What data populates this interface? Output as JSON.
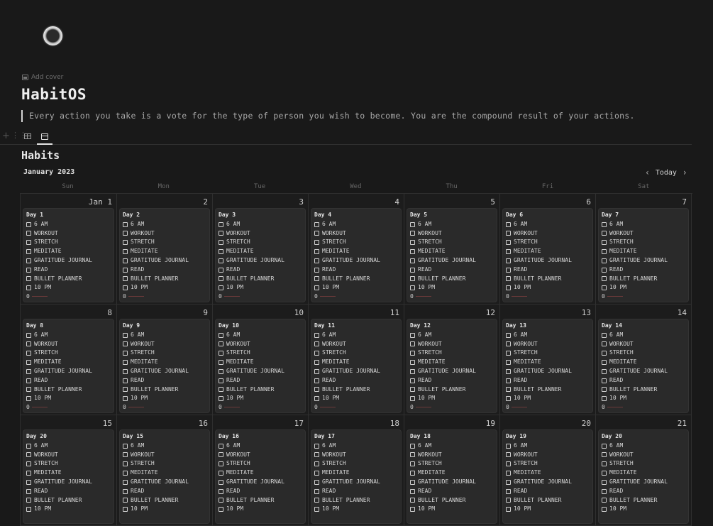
{
  "page": {
    "add_cover": "Add cover",
    "title": "HabitOS",
    "quote": "Every action you take is a vote for the type of person you wish to become. You are the compound result of your actions.",
    "database_title": "Habits"
  },
  "toolbar": {
    "views": [
      "table-view",
      "calendar-view"
    ],
    "active_view": "calendar-view"
  },
  "calendar": {
    "month_label": "January 2023",
    "today_label": "Today",
    "weekdays": [
      "Sun",
      "Mon",
      "Tue",
      "Wed",
      "Thu",
      "Fri",
      "Sat"
    ],
    "tasks": [
      "6 AM",
      "WORKOUT",
      "STRETCH",
      "MEDITATE",
      "GRATITUDE JOURNAL",
      "READ",
      "BULLET PLANNER",
      "10 PM"
    ],
    "weeks": [
      [
        {
          "date": "Jan 1",
          "title": "Day 1",
          "count": "0"
        },
        {
          "date": "2",
          "title": "Day 2",
          "count": "0"
        },
        {
          "date": "3",
          "title": "Day 3",
          "count": "0"
        },
        {
          "date": "4",
          "title": "Day 4",
          "count": "0"
        },
        {
          "date": "5",
          "title": "Day 5",
          "count": "0"
        },
        {
          "date": "6",
          "title": "Day 6",
          "count": "0"
        },
        {
          "date": "7",
          "title": "Day 7",
          "count": "0"
        }
      ],
      [
        {
          "date": "8",
          "title": "Day 8",
          "count": "0"
        },
        {
          "date": "9",
          "title": "Day 9",
          "count": "0"
        },
        {
          "date": "10",
          "title": "Day 10",
          "count": "0"
        },
        {
          "date": "11",
          "title": "Day 11",
          "count": "0"
        },
        {
          "date": "12",
          "title": "Day 12",
          "count": "0"
        },
        {
          "date": "13",
          "title": "Day 13",
          "count": "0"
        },
        {
          "date": "14",
          "title": "Day 14",
          "count": "0"
        }
      ],
      [
        {
          "date": "15",
          "title": "Day 20",
          "count": ""
        },
        {
          "date": "16",
          "title": "Day 15",
          "count": ""
        },
        {
          "date": "17",
          "title": "Day 16",
          "count": ""
        },
        {
          "date": "18",
          "title": "Day 17",
          "count": ""
        },
        {
          "date": "19",
          "title": "Day 18",
          "count": ""
        },
        {
          "date": "20",
          "title": "Day 19",
          "count": ""
        },
        {
          "date": "21",
          "title": "Day 20",
          "count": ""
        }
      ]
    ]
  },
  "colors": {
    "background": "#191919",
    "card": "#2a2a2a",
    "text": "#d4d4d4"
  }
}
